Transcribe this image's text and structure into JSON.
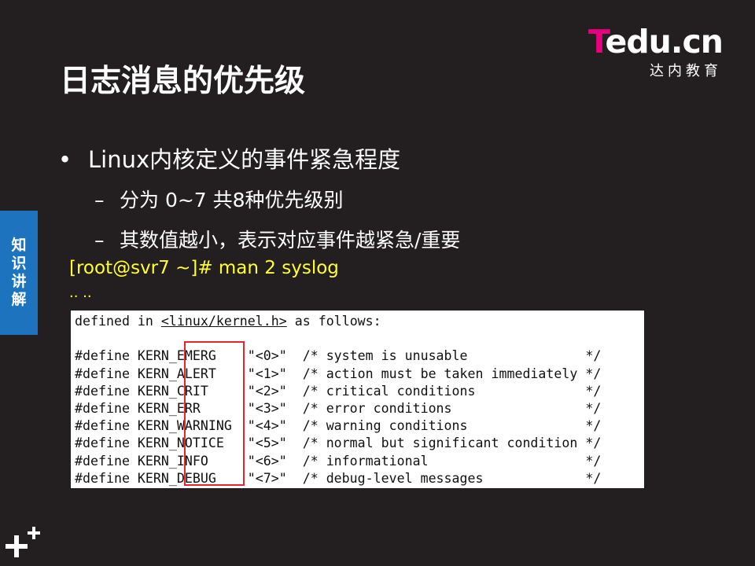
{
  "logo": {
    "brand_t": "T",
    "brand_rest": "edu",
    "brand_dot_cn": ".cn",
    "subtitle": "达内教育"
  },
  "slide": {
    "title": "日志消息的优先级",
    "bullet": "Linux内核定义的事件紧急程度",
    "sub_items": [
      "分为 0~7 共8种优先级别",
      "其数值越小，表示对应事件越紧急/重要"
    ],
    "side_tab": "知识讲解",
    "command": "[root@svr7 ~]# man  2  syslog",
    "ellipsis": ".. .."
  },
  "code": {
    "line0_pre": "defined in ",
    "line0_link": "<linux/kernel.h>",
    "line0_post": " as follows:",
    "lines": [
      "#define KERN_EMERG    \"<0>\"  /* system is unusable               */",
      "#define KERN_ALERT    \"<1>\"  /* action must be taken immediately */",
      "#define KERN_CRIT     \"<2>\"  /* critical conditions              */",
      "#define KERN_ERR      \"<3>\"  /* error conditions                 */",
      "#define KERN_WARNING  \"<4>\"  /* warning conditions               */",
      "#define KERN_NOTICE   \"<5>\"  /* normal but significant condition */",
      "#define KERN_INFO     \"<6>\"  /* informational                    */",
      "#define KERN_DEBUG    \"<7>\"  /* debug-level messages             */"
    ]
  },
  "colors": {
    "background": "#231f20",
    "accent_blue": "#1e73be",
    "command_yellow": "#ffff33",
    "highlight_red": "#e8252b",
    "brand_magenta": "#e6007e"
  }
}
